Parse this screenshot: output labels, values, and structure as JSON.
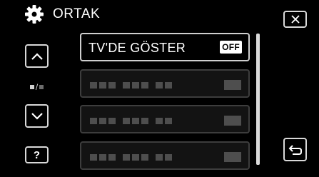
{
  "header": {
    "title": "ORTAK",
    "icon": "gear-icon"
  },
  "buttons": {
    "close": {
      "icon": "close-icon"
    },
    "up": {
      "icon": "arrow-up-icon"
    },
    "down": {
      "icon": "arrow-down-icon"
    },
    "help": {
      "label": "?"
    },
    "back": {
      "icon": "return-icon"
    }
  },
  "page_indicator": {
    "separator": "/"
  },
  "menu": {
    "items": [
      {
        "label": "TV'DE GÖSTER",
        "value": "OFF",
        "state": "active"
      },
      {
        "label": "",
        "value": "",
        "state": "disabled"
      },
      {
        "label": "",
        "value": "",
        "state": "disabled"
      },
      {
        "label": "",
        "value": "",
        "state": "disabled"
      }
    ]
  },
  "scrollbar": {
    "position_fraction": 0.0,
    "visible_fraction": 1.0
  },
  "colors": {
    "background": "#000000",
    "border": "#d9d9d9",
    "disabled": "#4e4e4e",
    "badge_bg": "#ffffff"
  }
}
